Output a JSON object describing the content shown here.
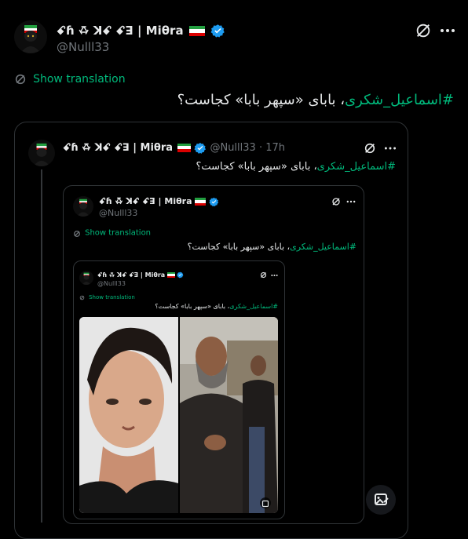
{
  "main_tweet": {
    "display_name": "ꗃꚕ ꗇ ꓘꗃ ꗃꓱ | Miθra",
    "handle": "@Nulll33",
    "show_translation": "Show translation",
    "hashtag": "#اسماعیل_شکری",
    "text": "، بابای «سپهر بابا» کجاست؟"
  },
  "quoted_tweet": {
    "display_name": "ꗃꚕ ꗇ ꓘꗃ ꗃꓱ | Miθra",
    "handle": "@Nulll33",
    "separator": "·",
    "time": "17h",
    "hashtag": "#اسماعیل_شکری",
    "text": "، بابای «سپهر بابا» کجاست؟"
  },
  "nested_tweet_1": {
    "display_name": "ꗃꚕ ꗇ ꓘꗃ ꗃꓱ | Miθra",
    "handle": "@Nulll33",
    "show_translation": "Show translation",
    "hashtag": "#اسماعیل_شکری",
    "text": "، بابای «سپهر بابا» کجاست؟"
  },
  "nested_tweet_2": {
    "display_name": "ꗃꚕ ꗇ ꓘꗃ ꗃꓱ | Miθra",
    "handle": "@Nulll33",
    "show_translation": "Show translation",
    "hashtag": "#اسماعیل_شکری",
    "text": "، بابای «سپهر بابا» کجاست؟"
  },
  "colors": {
    "accent_green": "#00ba7c",
    "verified_blue": "#1d9bf0",
    "border": "#2f3336",
    "muted": "#71767b"
  },
  "icons": [
    "grok-icon",
    "more-icon",
    "translate-icon",
    "verified-icon",
    "iran-flag-icon",
    "media-edit-icon"
  ]
}
